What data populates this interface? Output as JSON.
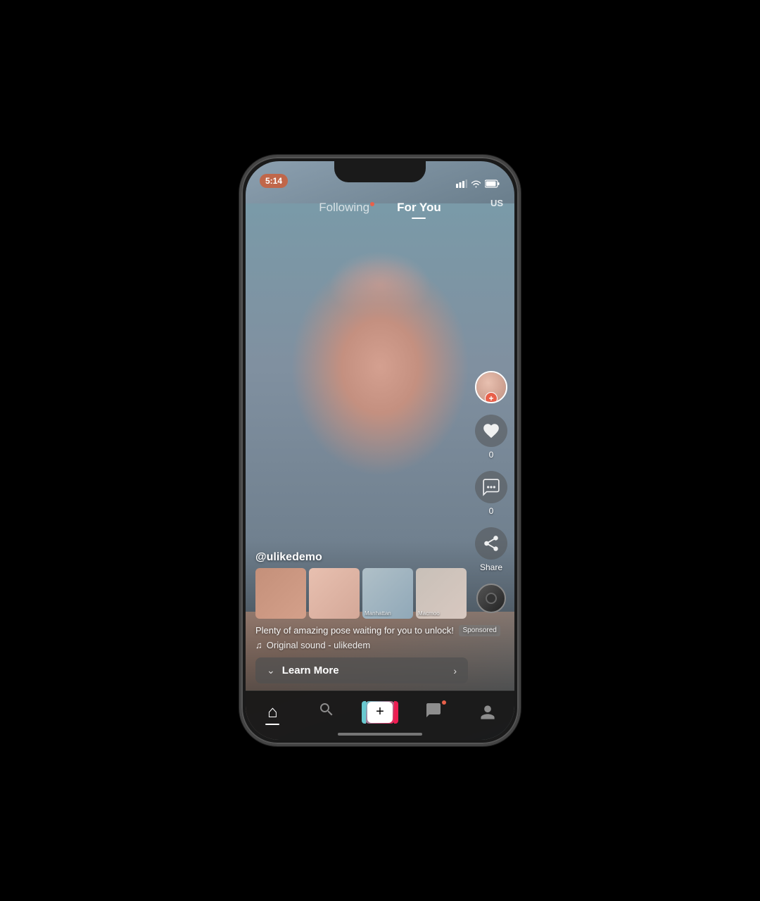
{
  "status_bar": {
    "time": "5:14",
    "region": "US"
  },
  "nav_tabs": {
    "following_label": "Following",
    "for_you_label": "For You",
    "active": "for_you"
  },
  "right_actions": {
    "like_count": "0",
    "comment_count": "0",
    "share_label": "Share"
  },
  "video_info": {
    "user_handle": "@ulikedemo",
    "description": "Plenty of amazing pose waiting for you to unlock!",
    "sponsored_label": "Sponsored",
    "sound": "Original sound - ulikedem",
    "thumbnails": [
      {
        "label": ""
      },
      {
        "label": ""
      },
      {
        "label": "Manhattan"
      },
      {
        "label": "Macmoo"
      }
    ]
  },
  "cta": {
    "learn_more_label": "Learn More"
  },
  "bottom_nav": {
    "home_label": "Home",
    "search_label": "Search",
    "add_label": "+",
    "messages_label": "Messages",
    "profile_label": "Profile"
  }
}
